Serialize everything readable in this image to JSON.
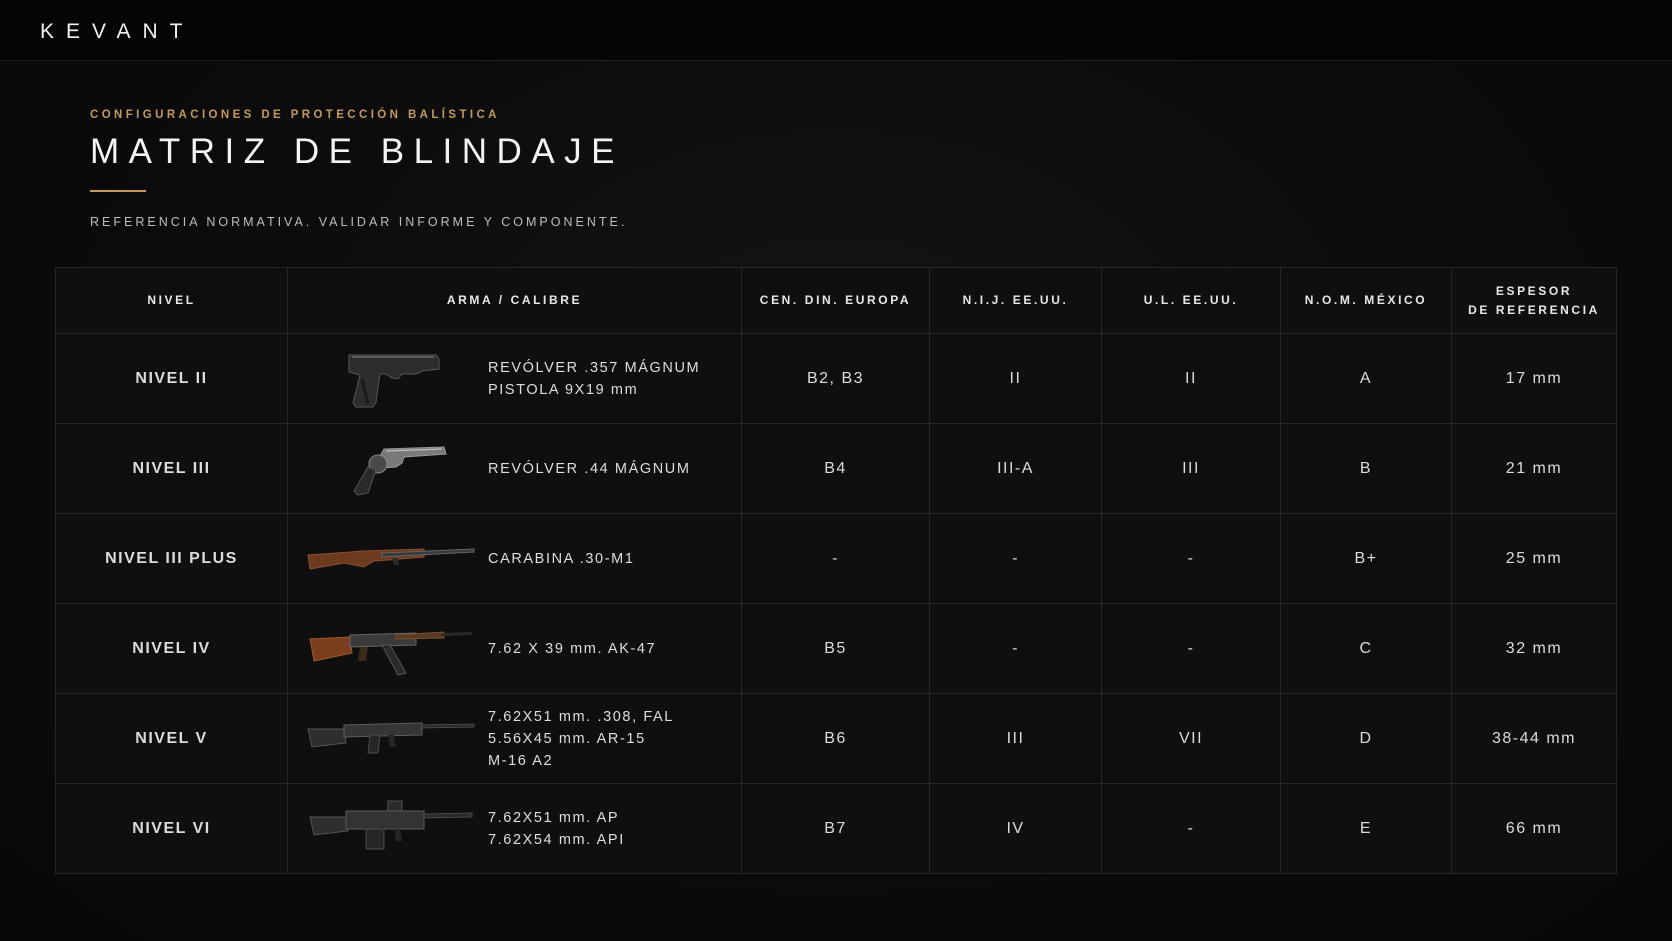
{
  "header": {
    "logo": "KEVANT"
  },
  "hero": {
    "eyebrow": "CONFIGURACIONES DE PROTECCIÓN BALÍSTICA",
    "title": "MATRIZ DE BLINDAJE",
    "subtitle": "REFERENCIA NORMATIVA. VALIDAR INFORME Y COMPONENTE."
  },
  "colors": {
    "accent": "#c49a5c",
    "background": "#0a0a0a",
    "text": "#f2f2f2"
  },
  "table": {
    "headers": {
      "nivel": "NIVEL",
      "arma": "ARMA / CALIBRE",
      "cen": "CEN. DIN. EUROPA",
      "nij": "N.I.J. EE.UU.",
      "ul": "U.L. EE.UU.",
      "nom": "N.O.M. MÉXICO",
      "espesor_1": "ESPESOR",
      "espesor_2": "DE REFERENCIA"
    },
    "rows": [
      {
        "nivel": "NIVEL II",
        "icon": "pistol-icon",
        "weapons": [
          "REVÓLVER .357 MÁGNUM",
          "PISTOLA 9X19 mm"
        ],
        "cen": "B2, B3",
        "nij": "II",
        "ul": "II",
        "nom": "A",
        "espesor": "17 mm"
      },
      {
        "nivel": "NIVEL III",
        "icon": "revolver-icon",
        "weapons": [
          "REVÓLVER .44 MÁGNUM"
        ],
        "cen": "B4",
        "nij": "III-A",
        "ul": "III",
        "nom": "B",
        "espesor": "21 mm"
      },
      {
        "nivel": "NIVEL III PLUS",
        "icon": "carbine-icon",
        "weapons": [
          "CARABINA .30-M1"
        ],
        "cen": "-",
        "nij": "-",
        "ul": "-",
        "nom": "B+",
        "espesor": "25 mm"
      },
      {
        "nivel": "NIVEL IV",
        "icon": "ak47-icon",
        "weapons": [
          "7.62 X 39 mm. AK-47"
        ],
        "cen": "B5",
        "nij": "-",
        "ul": "-",
        "nom": "C",
        "espesor": "32 mm"
      },
      {
        "nivel": "NIVEL V",
        "icon": "fal-rifle-icon",
        "weapons": [
          "7.62X51 mm. .308, FAL",
          "5.56X45 mm. AR-15",
          "M-16 A2"
        ],
        "cen": "B6",
        "nij": "III",
        "ul": "VII",
        "nom": "D",
        "espesor": "38-44 mm"
      },
      {
        "nivel": "NIVEL VI",
        "icon": "machine-gun-icon",
        "weapons": [
          "7.62X51 mm. AP",
          "7.62X54 mm. API"
        ],
        "cen": "B7",
        "nij": "IV",
        "ul": "-",
        "nom": "E",
        "espesor": "66 mm"
      }
    ]
  }
}
